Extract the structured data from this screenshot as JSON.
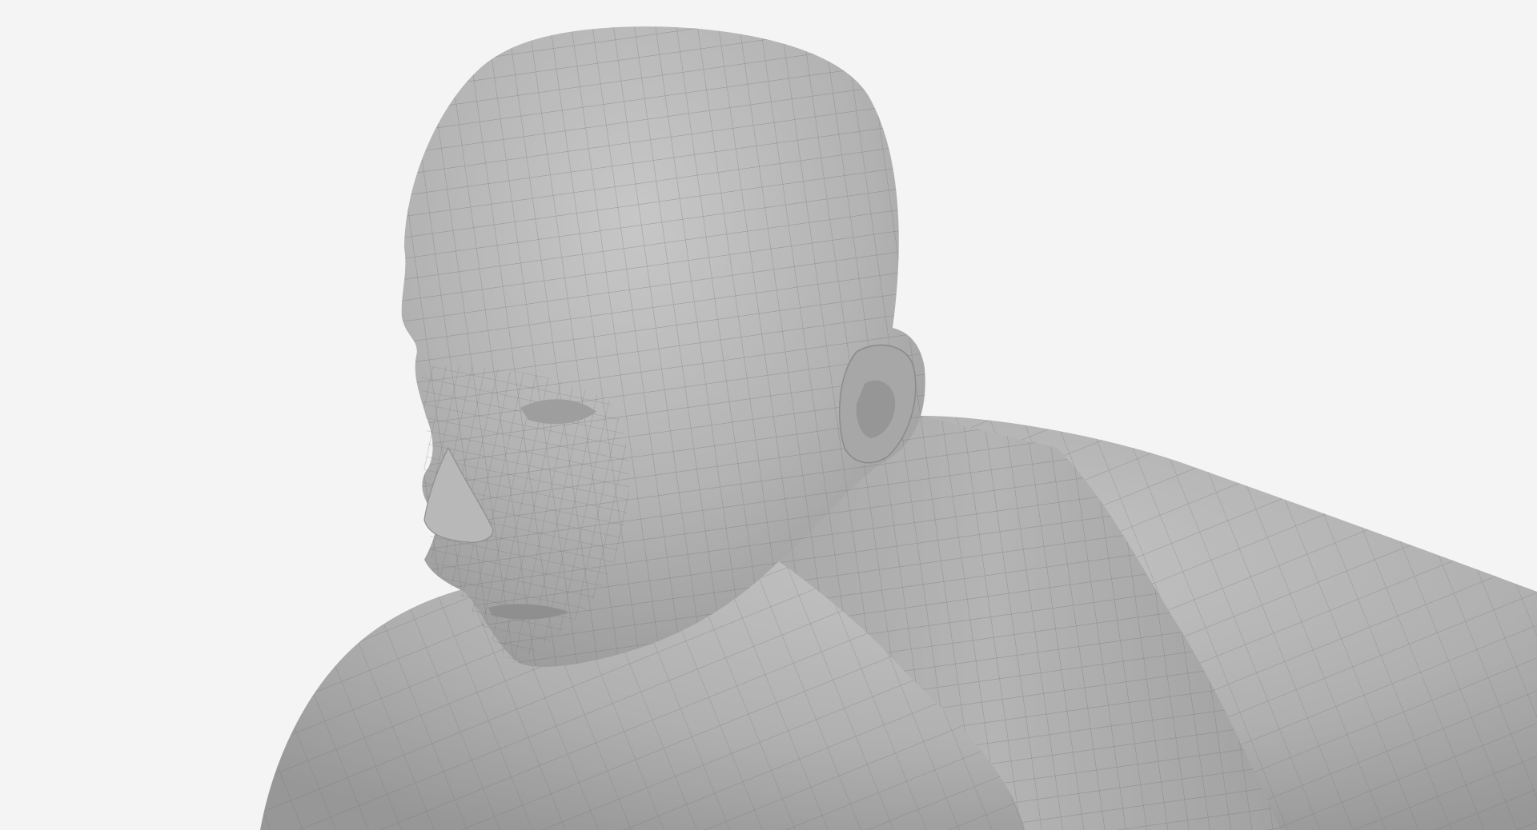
{
  "scene": {
    "subject": "3d-wireframe-male-bust",
    "render_style": "grey clay with quad mesh wireframe overlay",
    "colors": {
      "background": "#f4f4f4",
      "surface_light": "#c4c4c4",
      "surface_mid": "#a9a9a9",
      "surface_dark": "#8e8e8e",
      "wire": "#6f6f6f"
    }
  }
}
